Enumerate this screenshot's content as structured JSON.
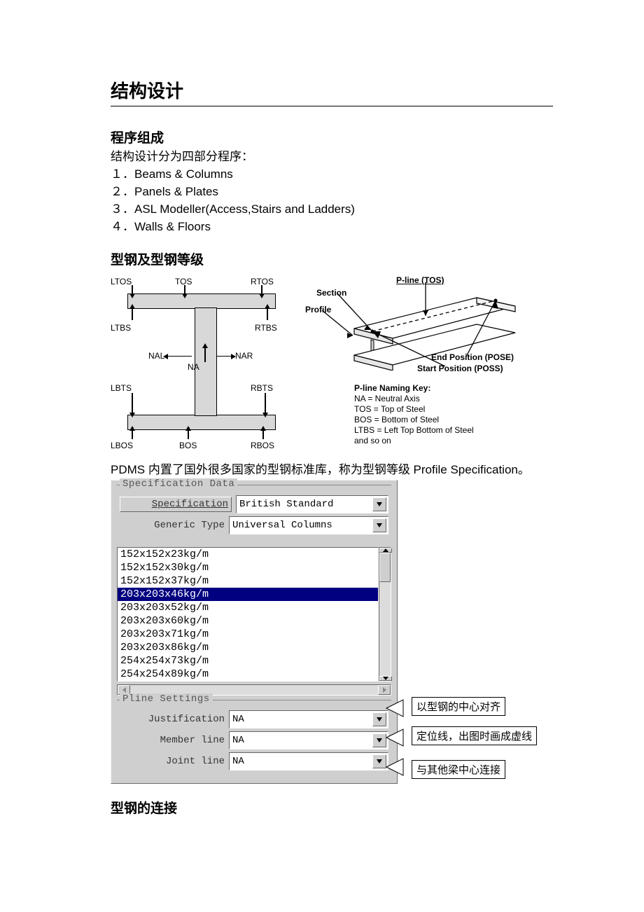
{
  "page_title": "结构设计",
  "section1": {
    "heading": "程序组成",
    "intro": "结构设计分为四部分程序：",
    "items": [
      "Beams & Columns",
      "Panels & Plates",
      "ASL Modeller(Access,Stairs and Ladders)",
      "Walls & Floors"
    ]
  },
  "section2": {
    "heading": "型钢及型钢等级",
    "ibeam_labels": {
      "LTOS": "LTOS",
      "TOS": "TOS",
      "RTOS": "RTOS",
      "LTBS": "LTBS",
      "RTBS": "RTBS",
      "NAL": "NAL",
      "NA": "NA",
      "NAR": "NAR",
      "LBTS": "LBTS",
      "RBTS": "RBTS",
      "LBOS": "LBOS",
      "BOS": "BOS",
      "RBOS": "RBOS"
    },
    "beam3d": {
      "pline_tos": "P-line (TOS)",
      "section": "Section",
      "profile": "Profile",
      "end_pos": "End Position (POSE)",
      "start_pos": "Start Position (POSS)",
      "key_title": "P-line Naming Key:",
      "key_na": "NA = Neutral Axis",
      "key_tos": "TOS = Top of Steel",
      "key_bos": "BOS = Bottom of Steel",
      "key_ltbs": "LTBS = Left Top Bottom of Steel",
      "key_etc": "  and so on"
    },
    "panel_caption": "PDMS 内置了国外很多国家的型钢标准库，称为型钢等级 Profile Specification。"
  },
  "panel": {
    "spec_group": "Specification Data",
    "spec_btn": "Specification",
    "spec_val": "British Standard",
    "gen_label": "Generic Type",
    "gen_val": "Universal Columns",
    "profiles": [
      "152x152x23kg/m",
      "152x152x30kg/m",
      "152x152x37kg/m",
      "203x203x46kg/m",
      "203x203x52kg/m",
      "203x203x60kg/m",
      "203x203x71kg/m",
      "203x203x86kg/m",
      "254x254x73kg/m",
      "254x254x89kg/m"
    ],
    "profiles_selected_index": 3,
    "pline_group": "Pline Settings",
    "justification_label": "Justification",
    "justification_val": "NA",
    "memberline_label": "Member line",
    "memberline_val": "NA",
    "jointline_label": "Joint line",
    "jointline_val": "NA"
  },
  "annotations": {
    "justification": "以型钢的中心对齐",
    "memberline": "定位线，出图时画成虚线",
    "jointline": "与其他梁中心连接"
  },
  "section3_heading": "型钢的连接"
}
